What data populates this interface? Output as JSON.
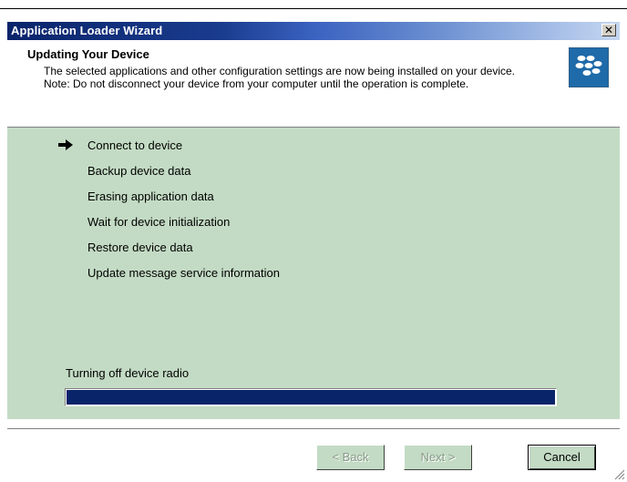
{
  "window": {
    "title": "Application Loader Wizard",
    "close_glyph": "✕"
  },
  "header": {
    "title": "Updating Your Device",
    "description": "The selected applications and other configuration settings are now being installed on your device. Note: Do not disconnect your device from your computer until the operation is complete.",
    "logo_icon": "blackberry-logo"
  },
  "steps": [
    {
      "label": "Connect to device",
      "current": true
    },
    {
      "label": "Backup device data",
      "current": false
    },
    {
      "label": "Erasing application data",
      "current": false
    },
    {
      "label": "Wait for device initialization",
      "current": false
    },
    {
      "label": "Restore device data",
      "current": false
    },
    {
      "label": "Update message service information",
      "current": false
    }
  ],
  "status": {
    "text": "Turning off device radio",
    "progress": 1.0
  },
  "buttons": {
    "back": "< Back",
    "next": "Next >",
    "cancel": "Cancel"
  },
  "colors": {
    "background": "#c3dbc4",
    "progress_fill": "#0a246a",
    "logo": "#1f6aa9"
  }
}
